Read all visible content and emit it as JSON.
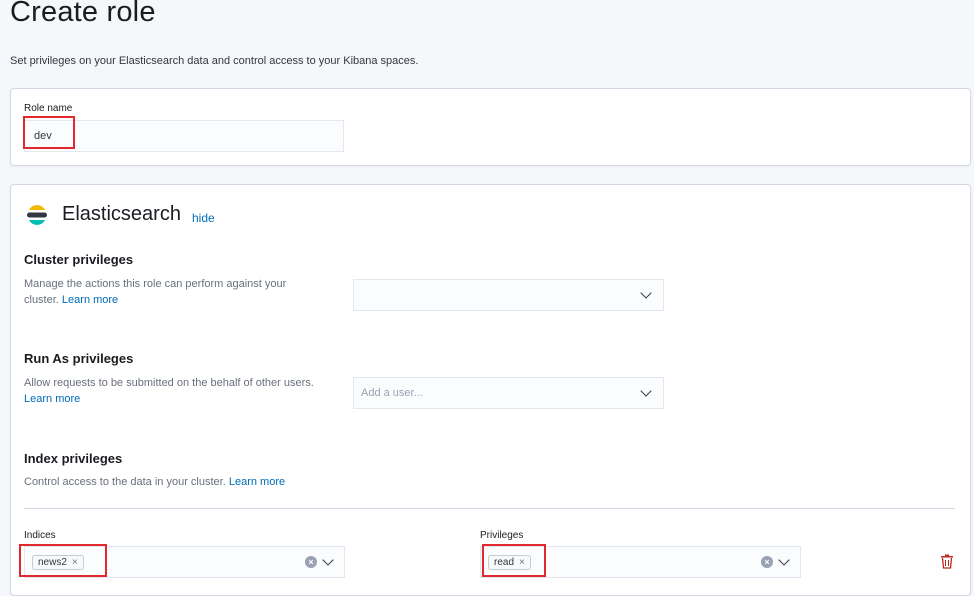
{
  "header": {
    "title": "Create role",
    "description": "Set privileges on your Elasticsearch data and control access to your Kibana spaces."
  },
  "role_name": {
    "label": "Role name",
    "value": "dev"
  },
  "elasticsearch": {
    "title": "Elasticsearch",
    "hide_link": "hide",
    "cluster": {
      "title": "Cluster privileges",
      "desc_line1": "Manage the actions this role can perform against your",
      "desc_line2": "cluster.",
      "learn_more": "Learn more"
    },
    "run_as": {
      "title": "Run As privileges",
      "desc_line1": "Allow requests to be submitted on the behalf of other users.",
      "learn_more": "Learn more",
      "placeholder": "Add a user..."
    },
    "index": {
      "title": "Index privileges",
      "desc": "Control access to the data in your cluster.",
      "learn_more": "Learn more",
      "indices_label": "Indices",
      "indices_value": "news2",
      "privileges_label": "Privileges",
      "privileges_value": "read",
      "pill_remove": "×",
      "clear": "×"
    }
  },
  "colors": {
    "link": "#006bb8",
    "highlight": "#e0282e",
    "delete": "#bd271e"
  }
}
